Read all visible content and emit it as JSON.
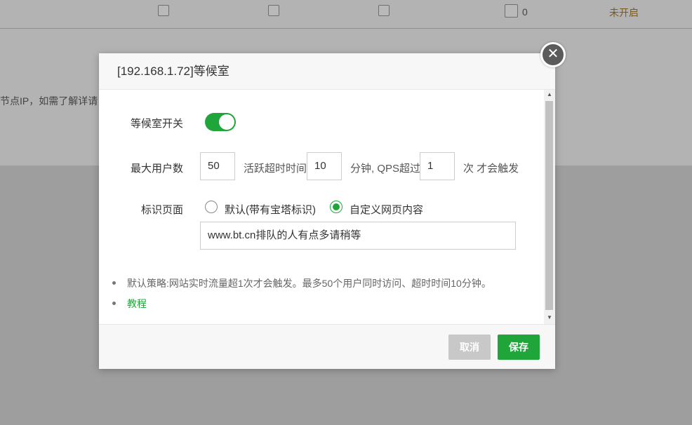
{
  "background": {
    "count": "0",
    "status": "未开启",
    "partial_text": "节点IP，如需了解详请"
  },
  "dialog": {
    "title": "[192.168.1.72]等候室",
    "close_icon": "close-icon",
    "switch": {
      "label": "等候室开关",
      "on": true
    },
    "max_users": {
      "label": "最大用户数",
      "value": "50"
    },
    "timeout": {
      "label": "活跃超时时间",
      "value": "10",
      "unit": "分钟, QPS超过"
    },
    "qps": {
      "value": "1",
      "suffix": "次 才会触发"
    },
    "page": {
      "label": "标识页面",
      "option_default": "默认(带有宝塔标识)",
      "option_custom": "自定义网页内容",
      "selected": "custom",
      "content": "www.bt.cn排队的人有点多请稍等"
    },
    "notes": [
      "默认策略:网站实时流量超1次才会触发。最多50个用户同时访问、超时时间10分钟。",
      "教程"
    ],
    "buttons": {
      "cancel": "取消",
      "save": "保存"
    },
    "colors": {
      "accent": "#20a53a",
      "link": "#20a53a"
    }
  }
}
